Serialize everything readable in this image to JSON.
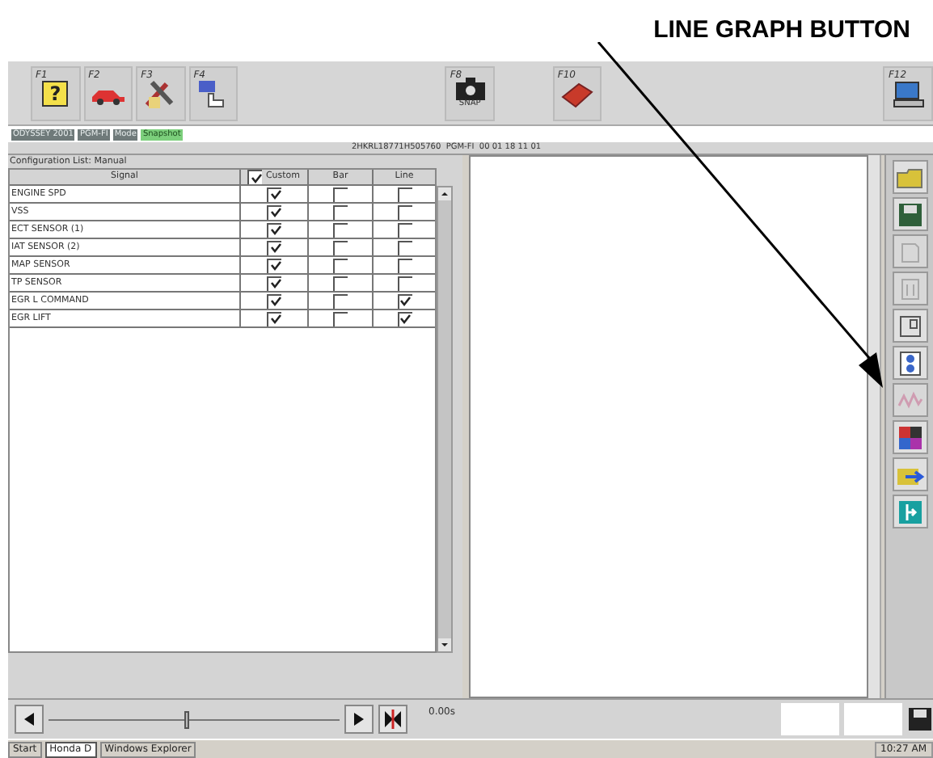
{
  "callout": {
    "label": "LINE GRAPH BUTTON"
  },
  "toolbar": [
    {
      "key": "F1",
      "kind": "help",
      "glyph": "?"
    },
    {
      "key": "F2",
      "kind": "car"
    },
    {
      "key": "F3",
      "kind": "tools"
    },
    {
      "key": "F4",
      "kind": "hand"
    },
    {
      "key": "F8",
      "kind": "camera",
      "caption": "SNAP"
    },
    {
      "key": "F10",
      "kind": "manual"
    },
    {
      "key": "F12",
      "kind": "print"
    }
  ],
  "info_bar": [
    {
      "text": "ODYSSEY 2001",
      "kind": "dark"
    },
    {
      "text": "PGM-FI",
      "kind": "dark"
    },
    {
      "text": "Mode",
      "kind": "dark"
    },
    {
      "text": "Snapshot",
      "kind": "green"
    }
  ],
  "title_bar": "2HKRL18771H505760  PGM-FI  00 01 18 11 01",
  "config": {
    "title": "Configuration List: Manual",
    "columns": [
      "Signal",
      "Custom",
      "Bar",
      "Line"
    ],
    "custom_header_checked": true,
    "rows": [
      {
        "signal": "ENGINE SPD",
        "custom": true,
        "bar": false,
        "line": false
      },
      {
        "signal": "VSS",
        "custom": true,
        "bar": false,
        "line": false
      },
      {
        "signal": "ECT SENSOR (1)",
        "custom": true,
        "bar": false,
        "line": false
      },
      {
        "signal": "IAT SENSOR (2)",
        "custom": true,
        "bar": false,
        "line": false
      },
      {
        "signal": "MAP SENSOR",
        "custom": true,
        "bar": false,
        "line": false
      },
      {
        "signal": "TP SENSOR",
        "custom": true,
        "bar": false,
        "line": false
      },
      {
        "signal": "EGR L COMMAND",
        "custom": true,
        "bar": false,
        "line": true
      },
      {
        "signal": "EGR LIFT",
        "custom": true,
        "bar": false,
        "line": true
      }
    ]
  },
  "side_tools": [
    {
      "kind": "open",
      "disabled": false
    },
    {
      "kind": "save",
      "disabled": false
    },
    {
      "kind": "page",
      "disabled": true
    },
    {
      "kind": "stack",
      "disabled": true
    },
    {
      "kind": "frame",
      "disabled": false
    },
    {
      "kind": "swap",
      "disabled": false
    },
    {
      "kind": "line-graph",
      "disabled": true
    },
    {
      "kind": "colors",
      "disabled": false
    },
    {
      "kind": "export",
      "disabled": false
    },
    {
      "kind": "exit",
      "disabled": false
    }
  ],
  "playback": {
    "level": 0.48,
    "time": "0.00s"
  },
  "taskbar": {
    "start": "Start",
    "tasks": [
      {
        "label": "Honda D",
        "selected": true
      },
      {
        "label": "Windows Explorer",
        "selected": false
      }
    ],
    "clock": "10:27 AM"
  }
}
